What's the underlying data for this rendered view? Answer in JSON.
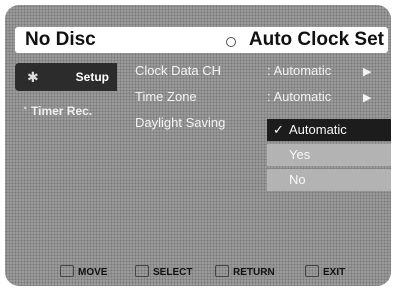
{
  "header": {
    "disc_status": "No Disc",
    "title": "Auto Clock Set",
    "title_icon": "clock-icon"
  },
  "sidebar": {
    "items": [
      {
        "label": "Setup",
        "icon": "gear-icon",
        "active": true
      },
      {
        "label": "Timer Rec.",
        "icon": "timer-icon",
        "active": false
      }
    ]
  },
  "settings": {
    "rows": [
      {
        "label": "Clock Data CH",
        "value": ": Automatic"
      },
      {
        "label": "Time Zone",
        "value": ": Automatic"
      },
      {
        "label": "Daylight Saving",
        "value": ""
      }
    ],
    "dropdown": {
      "options": [
        "Automatic",
        "Yes",
        "No"
      ],
      "selected": "Automatic"
    }
  },
  "footer": {
    "hints": [
      "MOVE",
      "SELECT",
      "RETURN",
      "EXIT"
    ]
  },
  "colors": {
    "panel": "#9a9a9a",
    "active_tab": "#2c2c2c",
    "option_bg": "#b3b3b3",
    "selected_option": "#1c1c1c"
  }
}
